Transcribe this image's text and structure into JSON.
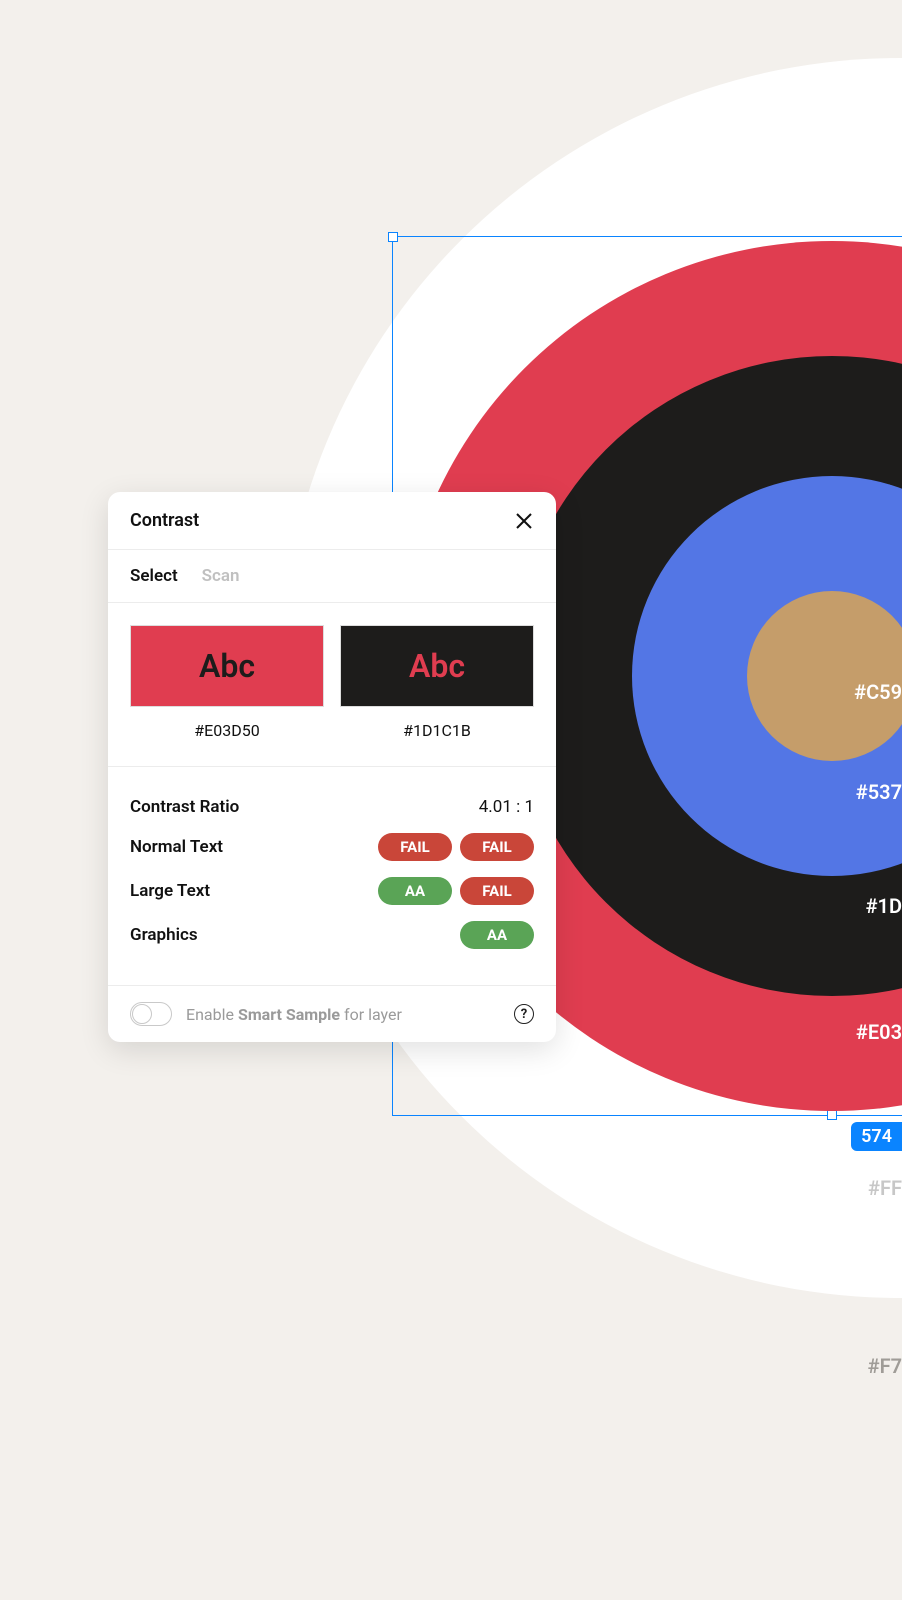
{
  "canvas": {
    "dimensionBadge": "574",
    "colorLabels": {
      "tan": "#C59",
      "blue": "#537",
      "black": "#1D",
      "red": "#E03",
      "white": "#FF",
      "bg": "#F7"
    },
    "ringColors": {
      "red": "#e03d50",
      "black": "#1d1c1b",
      "blue": "#5376e5",
      "tan": "#c59d6a"
    }
  },
  "panel": {
    "title": "Contrast",
    "tabs": {
      "select": "Select",
      "scan": "Scan"
    },
    "swatches": {
      "sampleText": "Abc",
      "fgHex": "#E03D50",
      "bgHex": "#1D1C1B"
    },
    "results": {
      "ratioLabel": "Contrast Ratio",
      "ratioValue": "4.01 : 1",
      "normalTextLabel": "Normal Text",
      "normalTextAA": "FAIL",
      "normalTextAAA": "FAIL",
      "largeTextLabel": "Large Text",
      "largeTextAA": "AA",
      "largeTextAAA": "FAIL",
      "graphicsLabel": "Graphics",
      "graphicsAA": "AA"
    },
    "footer": {
      "prefix": "Enable ",
      "emphasis": "Smart Sample",
      "suffix": " for layer"
    }
  }
}
